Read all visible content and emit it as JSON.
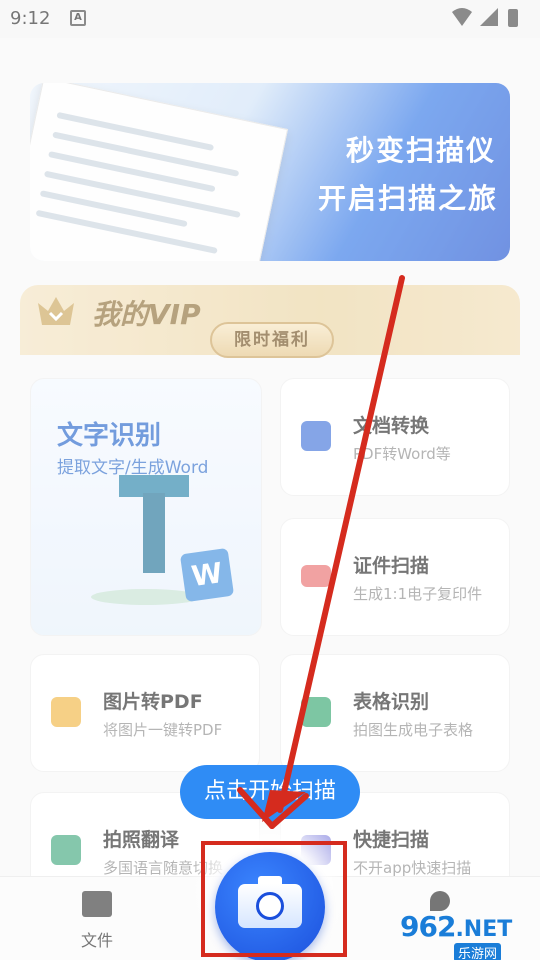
{
  "status_bar": {
    "time": "9:12",
    "notif_icon": "A"
  },
  "banner": {
    "line1": "秒变扫描仪",
    "line2": "开启扫描之旅"
  },
  "vip": {
    "title": "我的VIP",
    "badge": "限时福利"
  },
  "features": {
    "ocr": {
      "title": "文字识别",
      "subtitle": "提取文字/生成Word",
      "badge": "W"
    },
    "doc_convert": {
      "title": "文档转换",
      "subtitle": "PDF转Word等"
    },
    "id_scan": {
      "title": "证件扫描",
      "subtitle": "生成1:1电子复印件"
    },
    "img_pdf": {
      "title": "图片转PDF",
      "subtitle": "将图片一键转PDF"
    },
    "table_ocr": {
      "title": "表格识别",
      "subtitle": "拍图生成电子表格"
    },
    "translate": {
      "title": "拍照翻译",
      "subtitle": "多国语言随意切换"
    },
    "quick_scan": {
      "title": "快捷扫描",
      "subtitle": "不开app快速扫描"
    }
  },
  "tooltip": {
    "text": "点击开始扫描"
  },
  "bottom_nav": {
    "files_label": "文件"
  },
  "watermark": {
    "num": "962",
    "net": ".NET",
    "cn": "乐游网"
  },
  "colors": {
    "accent": "#2f8cf5",
    "cta": "#1b4fdc",
    "annotation": "#d52b1e",
    "vip_gold": "#ead39f"
  }
}
